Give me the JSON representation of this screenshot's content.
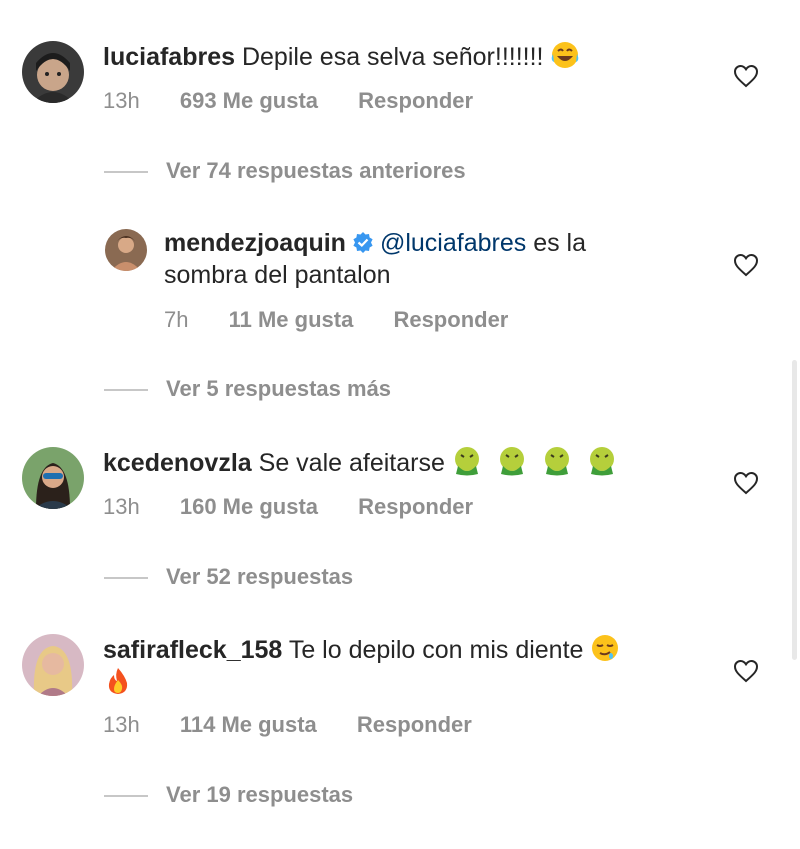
{
  "comments": [
    {
      "username": "luciafabres",
      "text": "Depile esa selva señor!!!!!!!",
      "time": "13h",
      "likes": "693 Me gusta",
      "reply": "Responder"
    },
    {
      "username": "mendezjoaquin",
      "mention": "@luciafabres",
      "text_line1": "es la",
      "text_line2": "sombra del pantalon",
      "time": "7h",
      "likes": "11 Me gusta",
      "reply": "Responder"
    },
    {
      "username": "kcedenovzla",
      "text": "Se vale afeitarse",
      "time": "13h",
      "likes": "160 Me gusta",
      "reply": "Responder"
    },
    {
      "username": "safirafleck_158",
      "text": "Te lo depilo con mis diente",
      "time": "13h",
      "likes": "114 Me gusta",
      "reply": "Responder"
    }
  ],
  "view_replies": [
    "Ver 74 respuestas anteriores",
    "Ver 5 respuestas más",
    "Ver 52 respuestas",
    "Ver 19 respuestas"
  ],
  "icons": {
    "like": "heart-outline-icon",
    "verified": "verified-badge-icon",
    "laugh": "face-with-tears-of-joy-emoji",
    "nauseated": "face-vomiting-emoji",
    "drool": "relieved-face-emoji",
    "fire": "fire-emoji"
  },
  "colors": {
    "text": "#262626",
    "secondary": "#8e8e8e",
    "mention": "#00376b",
    "verified": "#3897f0"
  }
}
